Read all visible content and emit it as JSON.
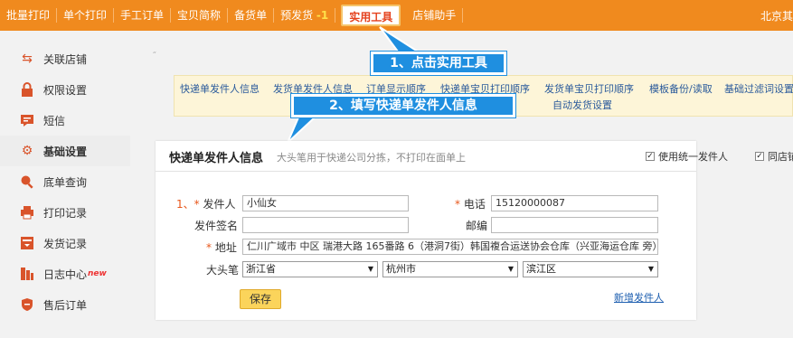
{
  "topnav": {
    "items": [
      "批量打印",
      "单个打印",
      "手工订单",
      "宝贝简称",
      "备货单",
      "预发货",
      "实用工具",
      "店铺助手"
    ],
    "preship_badge": "-1",
    "right_text": "北京其"
  },
  "sidebar": {
    "items": [
      {
        "label": "关联店铺",
        "icon": "link-arrows-icon"
      },
      {
        "label": "权限设置",
        "icon": "lock-icon"
      },
      {
        "label": "短信",
        "icon": "message-icon"
      },
      {
        "label": "基础设置",
        "icon": "gear-icon"
      },
      {
        "label": "底单查询",
        "icon": "search-icon"
      },
      {
        "label": "打印记录",
        "icon": "printer-icon"
      },
      {
        "label": "发货记录",
        "icon": "shipment-icon"
      },
      {
        "label": "日志中心",
        "icon": "log-icon",
        "badge": "new"
      },
      {
        "label": "售后订单",
        "icon": "aftersale-icon"
      }
    ]
  },
  "tabs": [
    "快递单发件人信息",
    "发货单发件人信息",
    "订单显示顺序",
    "快递单宝贝打印顺序",
    "发货单宝贝打印顺序",
    "模板备份/读取",
    "基础过滤词设置",
    "自动发货设置"
  ],
  "callouts": {
    "step1": "1、点击实用工具",
    "step2": "2、填写快递单发件人信息"
  },
  "panel": {
    "title": "快递单发件人信息",
    "subtitle": "大头笔用于快递公司分拣，不打印在面单上",
    "use_unified_sender": "使用统一发件人",
    "same_shop": "同店铺",
    "form": {
      "step_marker": "1、",
      "sender_label": "发件人",
      "sender_value": "小仙女",
      "phone_label": "电话",
      "phone_value": "15120000087",
      "signature_label": "发件签名",
      "signature_value": "",
      "zip_label": "邮编",
      "zip_value": "",
      "address_label": "地址",
      "address_value": "仁川广域市 中区 瑞港大路 165番路 6（港洞7街）韩国複合运送协会仓库（兴亚海运仓库 旁）",
      "bigpen_label": "大头笔",
      "province": "浙江省",
      "city": "杭州市",
      "district": "滨江区",
      "required_mark": "*"
    },
    "save_label": "保存",
    "add_sender_label": "新增发件人"
  },
  "colors": {
    "nav_orange": "#f08a1e",
    "callout_blue": "#1f8fe0",
    "required_orange": "#e8571c",
    "link_blue": "#1e5fb0"
  }
}
